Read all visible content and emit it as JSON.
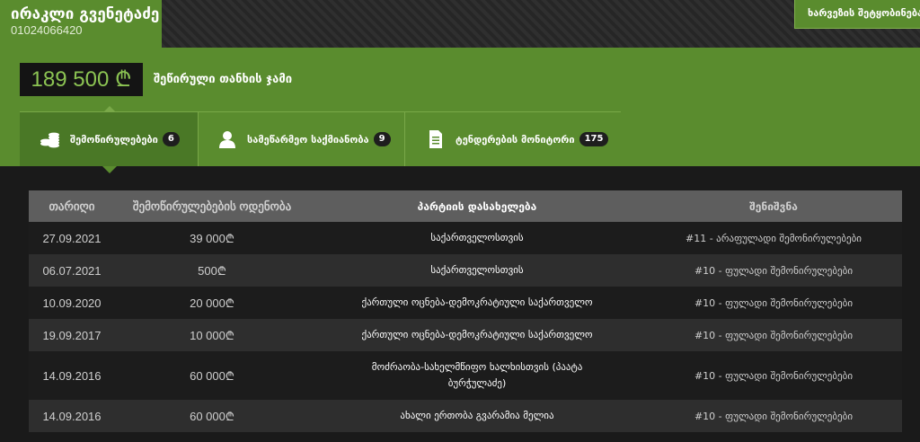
{
  "header": {
    "user_name": "ირაკლი გვენეტაძე",
    "user_id": "01024066420",
    "alert_button": "ხარვეზის შეტყობინება"
  },
  "summary": {
    "amount": "189 500 ₾",
    "label": "შეწირული თანხის ჯამი"
  },
  "tabs": [
    {
      "label": "შემოწირულებები",
      "count": "6",
      "icon": "coins-icon"
    },
    {
      "label": "სამეწარმეო საქმიანობა",
      "count": "9",
      "icon": "user-icon"
    },
    {
      "label": "ტენდერების მონიტორი",
      "count": "175",
      "icon": "document-icon"
    }
  ],
  "table": {
    "columns": [
      "თარიღი",
      "შემოწირულებების ოდენობა",
      "პარტიის დასახელება",
      "შენიშვნა"
    ],
    "rows": [
      {
        "date": "27.09.2021",
        "amount": "39 000₾",
        "party": "საქართველოსთვის",
        "note": "#11 - არაფულადი შემონირულებები"
      },
      {
        "date": "06.07.2021",
        "amount": "500₾",
        "party": "საქართველოსთვის",
        "note": "#10 - ფულადი შემონირულებები"
      },
      {
        "date": "10.09.2020",
        "amount": "20 000₾",
        "party": "ქართული ოცნება-დემოკრატიული საქართველო",
        "note": "#10 - ფულადი შემონირულებები"
      },
      {
        "date": "19.09.2017",
        "amount": "10 000₾",
        "party": "ქართული ოცნება-დემოკრატიული საქართველო",
        "note": "#10 - ფულადი შემონირულებები"
      },
      {
        "date": "14.09.2016",
        "amount": "60 000₾",
        "party": "მოძრაობა-სახელმწიფო ხალხისთვის (პაატა ბურჭულაძე)",
        "note": "#10 - ფულადი შემონირულებები"
      },
      {
        "date": "14.09.2016",
        "amount": "60 000₾",
        "party": "ახალი ერთობა გვარამია მელია",
        "note": "#10 - ფულადი შემონირულებები"
      }
    ]
  },
  "colors": {
    "brand_green": "#5a8c2e",
    "amount_green": "#8cc453",
    "table_header": "#5e5e5e"
  }
}
